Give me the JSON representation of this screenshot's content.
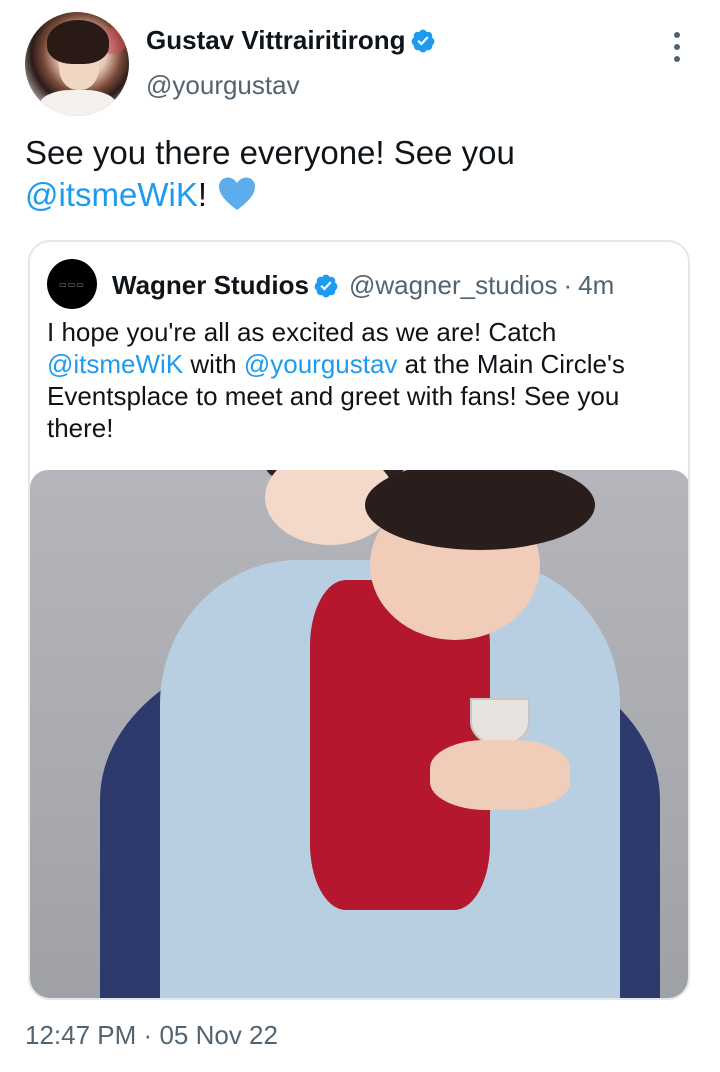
{
  "author": {
    "name": "Gustav Vittrairitirong",
    "handle": "@yourgustav",
    "verified": true,
    "avatar_desc": "avatar"
  },
  "tweet": {
    "text_before": "See you there everyone! See you ",
    "mention": "@itsmeWiK",
    "text_after": "!",
    "emoji": "blue-heart-icon"
  },
  "quoted": {
    "name": "Wagner Studios",
    "handle": "@wagner_studios",
    "separator": "·",
    "time": "4m",
    "verified": true,
    "text_part1": "I hope you're all as excited as we are! Catch ",
    "mention1": "@itsmeWiK",
    "text_part2": " with ",
    "mention2": "@yourgustav",
    "text_part3": " at the Main Circle's Eventsplace to meet and greet with fans! See you there!"
  },
  "footer": {
    "time": "12:47 PM",
    "separator": "·",
    "date": "05 Nov 22"
  },
  "colors": {
    "accent": "#1d9bf0",
    "secondary_text": "#536471",
    "primary_text": "#0f1419"
  }
}
